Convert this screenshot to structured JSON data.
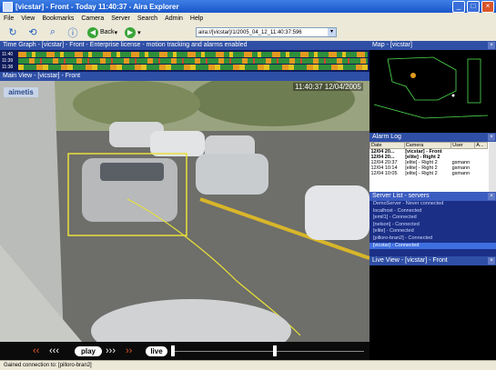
{
  "window": {
    "title": "[vicstar] - Front - Today 11:40:37 - Aira Explorer"
  },
  "menu": [
    "File",
    "View",
    "Bookmarks",
    "Camera",
    "Server",
    "Search",
    "Admin",
    "Help"
  ],
  "toolbar": {
    "back_label": "Back",
    "url": "aira://[vicstar]/1/2005_04_12_11:40:37:596"
  },
  "time_graph": {
    "title": "Time Graph - [vicstar] - Front - Enterprise license - motion tracking and alarms enabled",
    "rows": [
      "11:40",
      "11:39",
      "11:38"
    ]
  },
  "map_panel": {
    "title": "Map - [vicstar]"
  },
  "main_view": {
    "title": "Main View - [vicstar] - Front",
    "timestamp": "11:40:37 12/04/2005",
    "logo": "aimetis"
  },
  "playback": {
    "play_label": "play",
    "live_label": "live"
  },
  "alarm_log": {
    "title": "Alarm Log",
    "columns": [
      "Date",
      "Camera",
      "User",
      "A..."
    ],
    "rows": [
      {
        "date": "12/04 20...",
        "camera": "[vicstar] - Front",
        "user": "",
        "a": ""
      },
      {
        "date": "12/04 20...",
        "camera": "[elite] - Right 2",
        "user": "",
        "a": ""
      },
      {
        "date": "12/04 20:37",
        "camera": "[elite] - Right 2",
        "user": "gsmann",
        "a": ""
      },
      {
        "date": "12/04 10:14",
        "camera": "[elite] - Right 2",
        "user": "gsmann",
        "a": ""
      },
      {
        "date": "12/04 10:05",
        "camera": "[elite] - Right 2",
        "user": "gsmann",
        "a": ""
      }
    ]
  },
  "server_list": {
    "title": "Server List - servers",
    "items": [
      "DemoServer - Never connected",
      "localhost - Connected",
      "[emil1] - Connected",
      "[nelson] - Connected",
      "[elite] - Connected",
      "[pilloro-bran2] - Connected",
      "[vicstar] - Connected"
    ],
    "selected_index": 6
  },
  "live_view": {
    "title": "Live View - [vicstar] - Front"
  },
  "status": {
    "text": "Gained connection to: [pilloro-bran2]"
  }
}
